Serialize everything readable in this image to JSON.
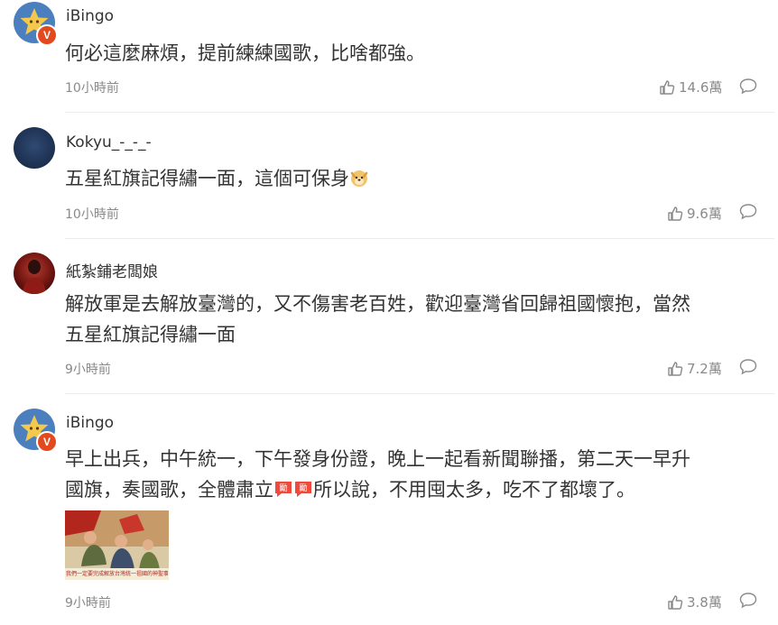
{
  "comments": [
    {
      "username": "iBingo",
      "text": "何必這麼麻煩，提前練練國歌，比啥都強。",
      "time": "10小時前",
      "likes": "14.6萬",
      "verified": "V"
    },
    {
      "username": "Kokyu_-_-_-",
      "text": "五星紅旗記得繡一面，這個可保身",
      "time": "10小時前",
      "likes": "9.6萬"
    },
    {
      "username": "紙紮鋪老闆娘",
      "text_line1": "解放軍是去解放臺灣的，又不傷害老百姓，歡迎臺灣省回歸祖國懷抱，當然",
      "text_line2": "五星紅旗記得繡一面",
      "time": "9小時前",
      "likes": "7.2萬"
    },
    {
      "username": "iBingo",
      "text_line1": "早上出兵，中午統一，下午發身份證，晚上一起看新聞聯播，第二天一早升",
      "text_line2a": "國旗，奏國歌，全體肅立",
      "text_line2b": "所以說，不用囤太多，吃不了都壞了。",
      "time": "9小時前",
      "likes": "3.8萬",
      "verified": "V",
      "emoji_label": "勵",
      "image_caption": "我們一定要完成解放台灣統一祖國的神聖事業"
    }
  ],
  "colors": {
    "meta": "#8a8a8a",
    "badge": "#e2491f",
    "divider": "#ececec"
  },
  "icons": [
    "star-avatar-icon",
    "thumbs-up-icon",
    "comment-bubble-icon",
    "doge-emoji-icon",
    "encourage-emoji-icon"
  ]
}
